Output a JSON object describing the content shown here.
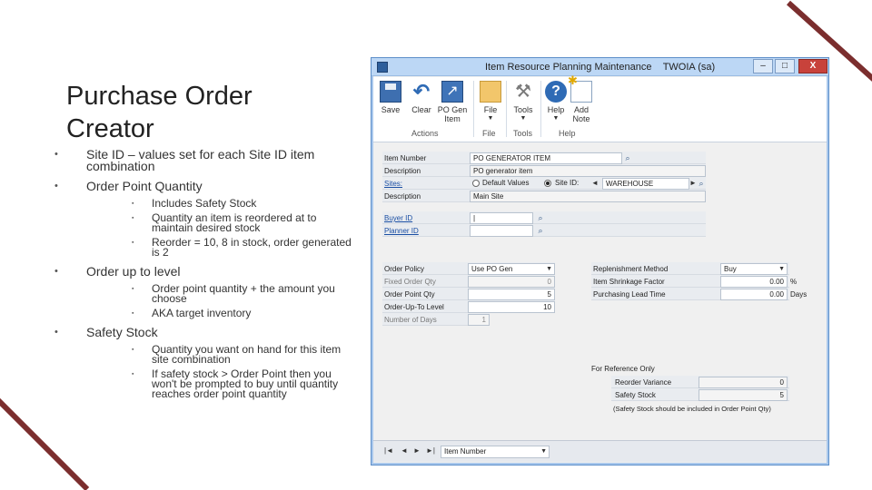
{
  "slide": {
    "title": "Purchase Order Creator",
    "bullets": [
      {
        "text": "Site ID – values set for each Site ID item combination",
        "sub": []
      },
      {
        "text": "Order Point Quantity",
        "sub": [
          "Includes Safety Stock",
          "Quantity an item is reordered at to maintain desired stock",
          "Reorder = 10, 8 in stock, order generated is 2"
        ]
      },
      {
        "text": "Order up to level",
        "sub": [
          "Order point quantity + the amount you choose",
          "AKA target inventory"
        ]
      },
      {
        "text": "Safety Stock",
        "sub": [
          "Quantity you want on hand for this item site combination",
          "If safety stock > Order Point then you won't be prompted to buy until quantity reaches order point quantity"
        ]
      }
    ]
  },
  "window": {
    "title": "Item Resource Planning Maintenance",
    "company": "TWOIA (sa)",
    "controls": {
      "minimize": "–",
      "maximize": "□",
      "close": "X"
    }
  },
  "ribbon": {
    "buttons": [
      {
        "label": "Save",
        "icon": "save-icon"
      },
      {
        "label": "Clear",
        "icon": "clear-icon"
      },
      {
        "label": "PO Gen Item",
        "icon": "po-gen-icon"
      },
      {
        "label": "File",
        "icon": "file-icon"
      },
      {
        "label": "Tools",
        "icon": "tools-icon"
      },
      {
        "label": "Help",
        "icon": "help-icon"
      },
      {
        "label": "Add Note",
        "icon": "add-note-icon"
      }
    ],
    "groups": {
      "actions": "Actions",
      "file": "File",
      "tools": "Tools",
      "help": "Help"
    },
    "arrow": "▼"
  },
  "form": {
    "item_number": {
      "label": "Item Number",
      "value": "PO GENERATOR ITEM"
    },
    "description": {
      "label": "Description",
      "value": "PO generator item"
    },
    "sites": {
      "label": "Sites:",
      "option_default": "Default Values",
      "option_site": "Site ID:",
      "site_value": "WAREHOUSE"
    },
    "site_description": {
      "label": "Description",
      "value": "Main Site"
    },
    "buyer_id": {
      "label": "Buyer ID",
      "value": "|"
    },
    "planner_id": {
      "label": "Planner ID",
      "value": ""
    },
    "order_policy": {
      "label": "Order Policy",
      "value": "Use PO Gen"
    },
    "fixed_order_qty": {
      "label": "Fixed Order Qty",
      "value": "0"
    },
    "order_point_qty": {
      "label": "Order Point Qty",
      "value": "5"
    },
    "order_up_to_level": {
      "label": "Order-Up-To Level",
      "value": "10"
    },
    "number_of_days": {
      "label": "Number of Days",
      "value": "1"
    },
    "replenishment_method": {
      "label": "Replenishment Method",
      "value": "Buy"
    },
    "item_shrinkage_factor": {
      "label": "Item Shrinkage Factor",
      "value": "0.00",
      "unit": "%"
    },
    "purchasing_lead_time": {
      "label": "Purchasing Lead Time",
      "value": "0.00",
      "unit": "Days"
    },
    "reference": {
      "heading": "For Reference Only",
      "reorder_variance": {
        "label": "Reorder Variance",
        "value": "0"
      },
      "safety_stock": {
        "label": "Safety Stock",
        "value": "5"
      },
      "note": "(Safety Stock should be included in Order Point Qty)"
    }
  },
  "statusbar": {
    "nav": [
      "|◄",
      "◄",
      "►",
      "►|"
    ],
    "sort_by": "Item Number"
  }
}
